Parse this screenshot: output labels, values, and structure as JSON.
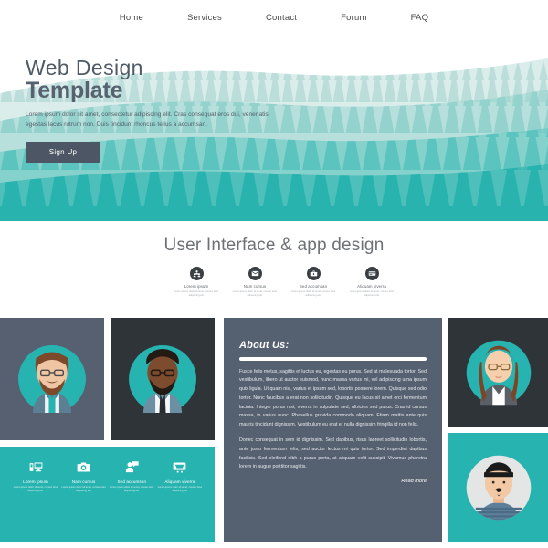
{
  "nav": {
    "items": [
      {
        "label": "Home"
      },
      {
        "label": "Services"
      },
      {
        "label": "Contact"
      },
      {
        "label": "Forum"
      },
      {
        "label": "FAQ"
      }
    ]
  },
  "hero": {
    "title_light": "Web Design",
    "title_bold": "Template",
    "paragraph": "Lorem ipsum dolor sit amet, consectetur adipiscing elit. Cras consequat eros dui, venenatis egestas lacus rutrum non. Duis tincidunt rhoncus tellus a accumsan.",
    "cta_label": "Sign Up",
    "colors": {
      "cta_bg": "#4d5664",
      "forest_front": "#29b3ae",
      "forest_mid": "#5cc4bf",
      "forest_back": "#93d2cd",
      "forest_far": "#bcdedb"
    }
  },
  "section": {
    "title": "User Interface & app design",
    "features": [
      {
        "icon": "people-icon",
        "label": "Lorem ipsum",
        "sub": "Lorem ipsum dolor sit amet, consec tetur adipiscing elit."
      },
      {
        "icon": "mail-icon",
        "label": "Nam cursus",
        "sub": "Lorem ipsum dolor sit amet, consec tetur adipiscing elit."
      },
      {
        "icon": "briefcase-icon",
        "label": "Sed accumsan",
        "sub": "Lorem ipsum dolor sit amet, consec tetur adipiscing elit."
      },
      {
        "icon": "credit-card-icon",
        "label": "Aliquam viverra",
        "sub": "Lorem ipsum dolor sit amet, consec tetur adipiscing elit."
      }
    ]
  },
  "about": {
    "heading": "About Us:",
    "paragraph1": "Fusce felis metus, sagittis et luctus eu, egestas eu purus. Sed at malesuada tortor. Sed vestibulum, libero ut auctor euismod, nunc massa varius mi, vel adipiscing urna ipsum quis ligula. Ut quam nisi, varius et ipsum sed, lobortis posuere lorem. Quisque sed odio tortor. Nunc faucibus a erat non sollicitudin. Quisque eu lacus sit amet orci fermentum lacinia. Integer purus nisi, viverra in vulputate sed, ultricies sed purus. Cras id cursus massa, in varius nunc. Phasellus gravida commodo aliquam. Etiam mattis ante quis mauris tincidunt dignissim. Vestibulum eu erat et nulla dignissim fringilla id non felis.",
    "paragraph2": "Donec consequat in sem id dignissim. Sed dapibus, risus laoreet sollicitudin lobortis, ante justo fermentum felis, sed auctor lectus mi quis tortor. Sed imperdiet dapibus facilisis. Sed eleifend nibh a purus porta, at aliquam velit suscipit. Vivamus pharetra lorem in augue porttitor sagittis.",
    "read_more": "Read more",
    "bg_color": "#556070"
  },
  "teal_features": {
    "bg_color": "#27b3b0",
    "items": [
      {
        "icon": "devices-icon",
        "label": "Lorem ipsum",
        "sub": "Lorem ipsum dolor sit amet, consec tetur adipiscing elit."
      },
      {
        "icon": "camera-icon",
        "label": "Nam cursus",
        "sub": "Lorem ipsum dolor sit amet, consec tetur adipiscing elit."
      },
      {
        "icon": "user-chat-icon",
        "label": "Sed accumsan",
        "sub": "Lorem ipsum dolor sit amet, consec tetur adipiscing elit."
      },
      {
        "icon": "shopping-cart-icon",
        "label": "Aliquam viverra",
        "sub": "Lorem ipsum dolor sit amet, consec tetur adipiscing elit."
      }
    ]
  },
  "avatars": [
    {
      "name": "bearded-man-avatar",
      "panel_bg": "#566070",
      "circle": "#27b3b0"
    },
    {
      "name": "dark-skinned-man-avatar",
      "panel_bg": "#2f3439",
      "circle": "#27b3b0"
    },
    {
      "name": "woman-glasses-avatar",
      "panel_bg": "#2f3439",
      "circle": "#27b3b0"
    },
    {
      "name": "striped-shirt-man-avatar",
      "panel_bg": "#27b3b0",
      "circle": "#e4e6e6"
    }
  ]
}
